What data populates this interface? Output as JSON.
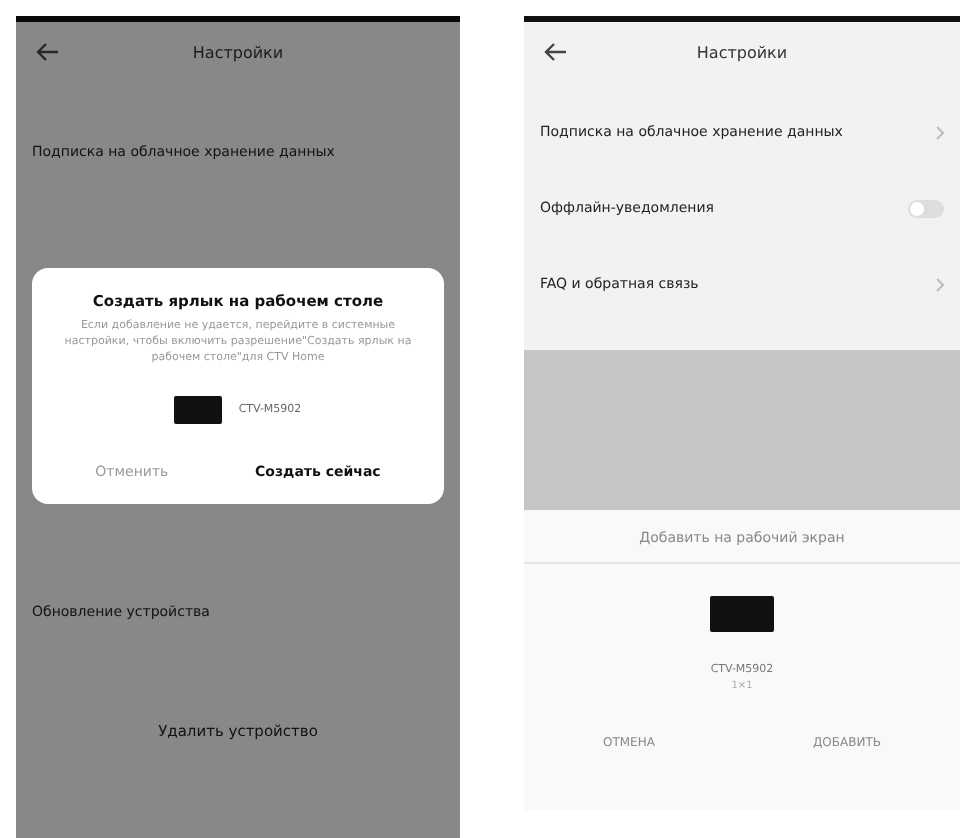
{
  "left_screen": {
    "title": "Настройки",
    "rows": [
      "Подписка на облачное хранение данных"
    ],
    "dialog": {
      "title": "Создать ярлык на рабочем столе",
      "message": "Если добавление не удается, перейдите в системные настройки, чтобы включить разрешение\"Создать ярлык на рабочем столе\"для CTV Home",
      "device": "CTV-M5902",
      "buttons": [
        {
          "label": "Отменить",
          "primary": false
        },
        {
          "label": "Создать сейчас",
          "primary": true
        }
      ]
    },
    "below_rows": [
      "Обновление устройства"
    ],
    "delete_button": "Удалить устройство"
  },
  "right_screen": {
    "title": "Настройки",
    "rows": [
      {
        "kind": "link",
        "label": "Подписка на облачное хранение данных"
      },
      {
        "kind": "toggle",
        "label": "Оффлайн-уведомления",
        "on": false
      },
      {
        "kind": "link",
        "label": "FAQ и обратная связь"
      }
    ],
    "sheet": {
      "title": "Добавить на рабочий экран",
      "device": "CTV-M5902",
      "size": "1×1",
      "buttons": [
        "ОТМЕНА",
        "ДОБАВИТЬ"
      ]
    }
  }
}
